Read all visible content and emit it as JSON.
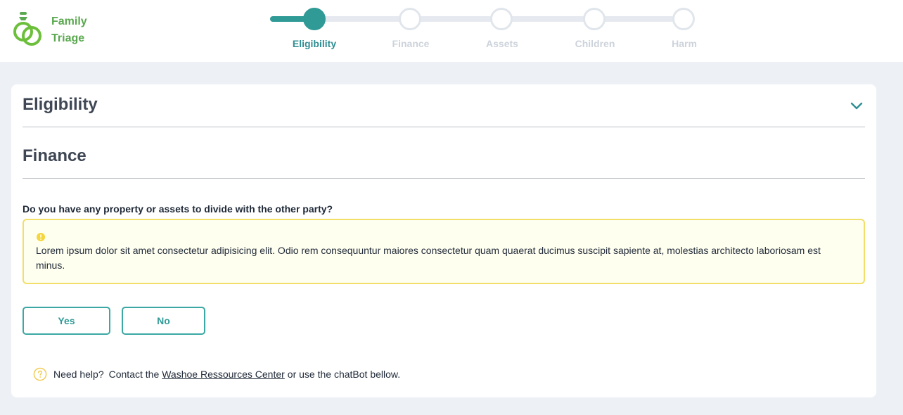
{
  "brand": {
    "line1": "Family",
    "line2": "Triage",
    "color": "#5aa84f"
  },
  "stepper": {
    "active_index": 0,
    "steps": [
      {
        "label": "Eligibility"
      },
      {
        "label": "Finance"
      },
      {
        "label": "Assets"
      },
      {
        "label": "Children"
      },
      {
        "label": "Harm"
      }
    ],
    "accent": "#2f9a96"
  },
  "sections": {
    "eligibility": {
      "title": "Eligibility",
      "icon": "chevron-down-icon"
    },
    "finance": {
      "title": "Finance"
    }
  },
  "question": {
    "text": "Do you have any property or assets to divide with the other party?",
    "alert": {
      "icon": "warning-dot-icon",
      "text": "Lorem ipsum dolor sit amet consectetur adipisicing elit. Odio rem consequuntur maiores consectetur quam quaerat ducimus suscipit sapiente at, molestias architecto laboriosam est minus."
    },
    "answers": {
      "yes": "Yes",
      "no": "No"
    }
  },
  "help": {
    "icon": "question-circle-icon",
    "prefix": "Need help?",
    "contact": "Contact the",
    "link": "Washoe Ressources Center",
    "suffix": "or use the chatBot bellow."
  }
}
